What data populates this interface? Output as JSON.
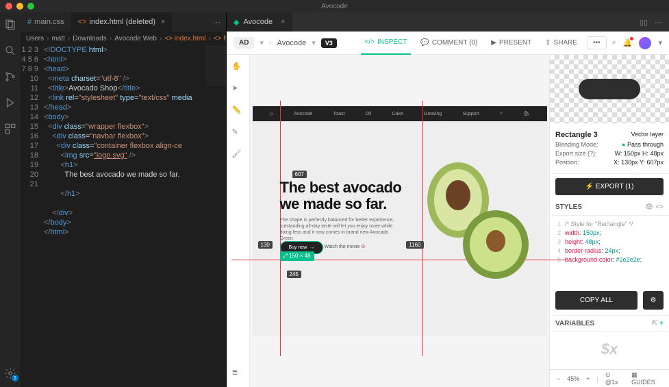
{
  "app_title": "Avocode",
  "traffic": {
    "close": "#ff5f56",
    "min": "#ffbd2e",
    "max": "#27c93f"
  },
  "editor": {
    "tabs": [
      {
        "icon": "#",
        "label": "main.css",
        "color": "#519aba"
      },
      {
        "icon": "<>",
        "label": "index.html (deleted)",
        "color": "#e37933"
      }
    ],
    "breadcrumb": [
      "Users",
      "matt",
      "Downloads",
      "Avocode Web",
      "<> index.html",
      "<> html"
    ],
    "code_lines": [
      {
        "n": 1,
        "html": "<span class='p1'>&lt;!</span><span class='p2'>DOCTYPE</span> <span class='p3'>html</span><span class='p1'>&gt;</span>"
      },
      {
        "n": 2,
        "html": "<span class='p1'>&lt;</span><span class='p2'>html</span><span class='p1'>&gt;</span>"
      },
      {
        "n": 3,
        "html": "<span class='p1'>&lt;</span><span class='p2'>head</span><span class='p1'>&gt;</span>"
      },
      {
        "n": 4,
        "html": "  <span class='p1'>&lt;</span><span class='p2'>meta</span> <span class='p3'>charset</span>=<span class='p4'>\"utf-8\"</span> <span class='p1'>/&gt;</span>"
      },
      {
        "n": 5,
        "html": "  <span class='p1'>&lt;</span><span class='p2'>title</span><span class='p1'>&gt;</span>Avocado Shop<span class='p1'>&lt;/</span><span class='p2'>title</span><span class='p1'>&gt;</span>"
      },
      {
        "n": 6,
        "html": "  <span class='p1'>&lt;</span><span class='p2'>link</span> <span class='p3'>rel</span>=<span class='p4'>\"stylesheet\"</span> <span class='p3'>type</span>=<span class='p4'>\"text/css\"</span> <span class='p3'>media</span>"
      },
      {
        "n": 7,
        "html": "<span class='p1'>&lt;/</span><span class='p2'>head</span><span class='p1'>&gt;</span>"
      },
      {
        "n": 8,
        "html": "<span class='p1'>&lt;</span><span class='p2'>body</span><span class='p1'>&gt;</span>"
      },
      {
        "n": 9,
        "html": "  <span class='p1'>&lt;</span><span class='p2'>div</span> <span class='p3'>class</span>=<span class='p4'>\"wrapper flexbox\"</span><span class='p1'>&gt;</span>"
      },
      {
        "n": 10,
        "html": "    <span class='p1'>&lt;</span><span class='p2'>div</span> <span class='p3'>class</span>=<span class='p4'>\"navbar flexbox\"</span><span class='p1'>&gt;</span>"
      },
      {
        "n": 11,
        "html": "      <span class='p1'>&lt;</span><span class='p2'>div</span> <span class='p3'>class</span>=<span class='p4'>\"container flexbox align-ce</span>"
      },
      {
        "n": 12,
        "html": "        <span class='p1'>&lt;</span><span class='p2'>img</span> <span class='p3'>src</span>=<span class='p4 underline'>\"logo.svg\"</span> <span class='p1'>/&gt;</span>"
      },
      {
        "n": 13,
        "html": "        <span class='p1'>&lt;</span><span class='p2'>h1</span><span class='p1'>&gt;</span>"
      },
      {
        "n": 14,
        "html": "          The best avocado we made so far."
      },
      {
        "n": 15,
        "html": ""
      },
      {
        "n": 16,
        "html": "        <span class='p1'>&lt;/</span><span class='p2'>h1</span><span class='p1'>&gt;</span>"
      },
      {
        "n": 17,
        "html": ""
      },
      {
        "n": 18,
        "html": "    <span class='p1'>&lt;/</span><span class='p2'>div</span><span class='p1'>&gt;</span>"
      },
      {
        "n": 19,
        "html": "<span class='p1'>&lt;/</span><span class='p2'>body</span><span class='p1'>&gt;</span>"
      },
      {
        "n": 20,
        "html": "<span class='p1'>&lt;/</span><span class='p2'>html</span><span class='p1'>&gt;</span>"
      },
      {
        "n": 21,
        "html": ""
      }
    ]
  },
  "avocode": {
    "tab_label": "Avocode",
    "version": "AD",
    "crumb": "Avocode",
    "badge": "V3",
    "actions": {
      "inspect": "INSPECT",
      "comment": "COMMENT (0)",
      "present": "PRESENT",
      "share": "SHARE"
    },
    "design": {
      "nav": [
        "Avocode",
        "Toast",
        "Oil",
        "Cake",
        "Growing",
        "Support"
      ],
      "headline": "The best avocado\nwe made so far.",
      "sub": "The shape is perfectly balanced for better experience, outstanding all-day taste will let you enjoy more while doing less and it now comes in brand new Avocado Green",
      "buy": "Buy now",
      "watch": "Watch the movie",
      "measures": {
        "top": "607",
        "left": "130",
        "right": "1160",
        "bottom": "245",
        "size": "150 × 48"
      }
    },
    "inspect": {
      "layer_name": "Rectangle 3",
      "layer_type": "Vector layer",
      "blending_mode": "Blending Mode:",
      "blending_val": "Pass through",
      "export_size": "Export size (?):",
      "export_w": "W: 150px",
      "export_h": "H: 48px",
      "position": "Position:",
      "pos_x": "X: 130px",
      "pos_y": "Y: 607px",
      "export_btn": "EXPORT (1)",
      "styles_label": "STYLES",
      "css": [
        {
          "n": 1,
          "html": "<span class='c-cmt'>/* Style for \"Rectangle\" */</span>"
        },
        {
          "n": 2,
          "html": "<span class='c-prop'>width</span>: <span class='c-val'>150px</span>;"
        },
        {
          "n": 3,
          "html": "<span class='c-prop'>height</span>: <span class='c-val'>48px</span>;"
        },
        {
          "n": 4,
          "html": "<span class='c-prop'>border-radius</span>: <span class='c-val'>24px</span>;"
        },
        {
          "n": 5,
          "html": "<span class='c-prop'>background-color</span>: <span class='c-val'>#2e2e2e</span>;"
        }
      ],
      "copy_all": "COPY ALL",
      "variables": "VARIABLES",
      "dollar": "$x"
    },
    "footer": {
      "zoom": "45%",
      "scale": "@1x",
      "guides": "GUIDES"
    }
  }
}
